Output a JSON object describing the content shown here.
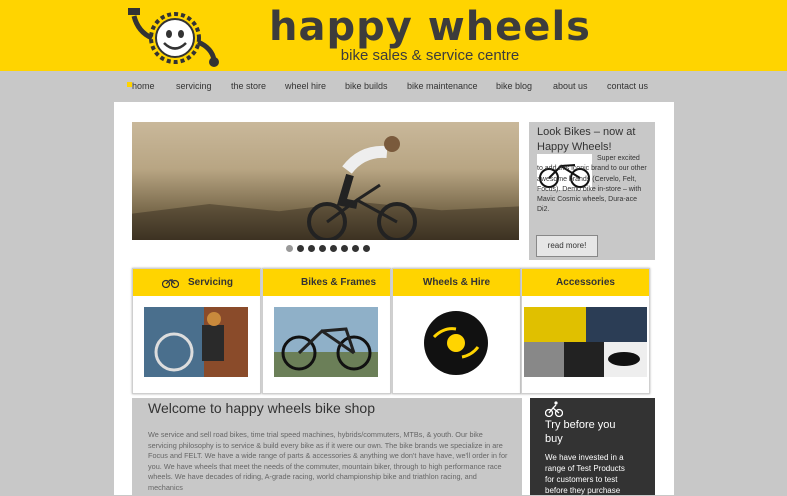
{
  "brand": {
    "name": "happy wheels",
    "tagline": "bike sales & service centre"
  },
  "nav": {
    "items": [
      "home",
      "servicing",
      "the store",
      "wheel hire",
      "bike builds",
      "bike maintenance",
      "bike blog",
      "about us",
      "contact us"
    ]
  },
  "slider": {
    "dots": 8
  },
  "sidebar_news": {
    "title": "Look Bikes – now at Happy Wheels!",
    "body": "Super excited to add this iconic brand to our other awesome brands (Cervelo, Felt, Focus). Demo bike in-store – with Mavic Cosmic wheels, Dura-ace Di2.",
    "button": "read more!"
  },
  "cards": [
    {
      "title": "Servicing",
      "icon": "bicycle-icon"
    },
    {
      "title": "Bikes & Frames"
    },
    {
      "title": "Wheels & Hire"
    },
    {
      "title": "Accessories"
    }
  ],
  "welcome": {
    "title": "Welcome to happy wheels bike shop",
    "body": "We service and sell road bikes, time trial speed machines, hybrids/commuters, MTBs, & youth. Our bike servicing philosophy is to service & build every bike as if it were our own. The bike brands we specialize in are Focus and FELT. We have a wide range of parts & accessories & anything we don't have have, we'll order in for you. We have wheels that meet the needs of the commuter, mountain biker, through to high performance race wheels. We have decades of riding, A-grade racing, world championship bike and triathlon racing, and mechanics"
  },
  "try_box": {
    "icon": "cyclist-icon",
    "title": "Try before you buy",
    "body": "We have invested in a range of Test Products for customers to test before they purchase"
  },
  "colors": {
    "accent": "#ffd400",
    "text": "#333333",
    "background": "#c8c8c8"
  }
}
